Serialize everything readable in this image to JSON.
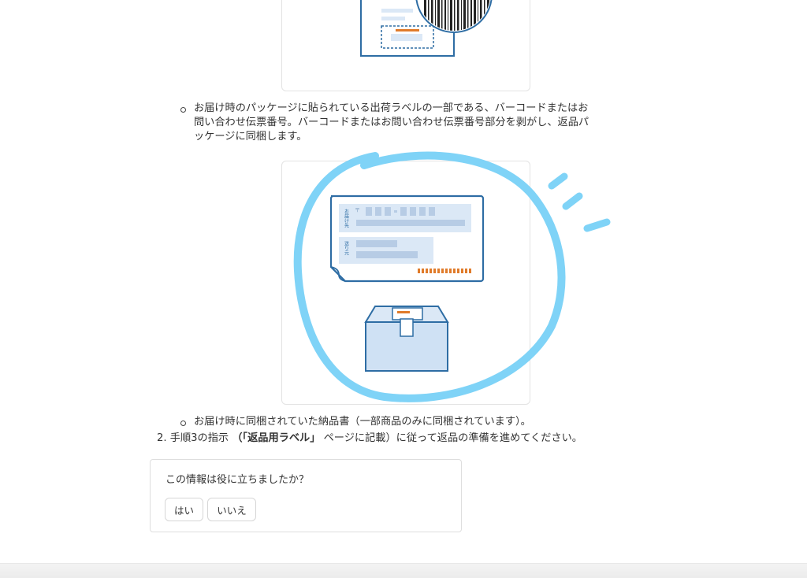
{
  "bullets": {
    "barcode_label_text": "お届け時のパッケージに貼られている出荷ラベルの一部である、バーコードまたはお問い合わせ伝票番号。バーコードまたはお問い合わせ伝票番号部分を剥がし、返品パッケージに同梱します。",
    "barcode_label_lines": [
      "お届け時のパッケージに貼られている出荷ラベルの一部である、バーコードまたはお",
      "問い合わせ伝票番号。バーコードまたはお問い合わせ伝票番号部分を剥がし、返品パ",
      "ッケージに同梱します。"
    ],
    "invoice_text": "お届け時に同梱されていた納品書（一部商品のみに同梱されています）。"
  },
  "illustration": {
    "label_recipient": "お届け先",
    "label_sender": "送り元",
    "postal_mark": "〒"
  },
  "step": {
    "number": "2.",
    "prefix": "手順3の指示",
    "bold": "（「返品用ラベル」",
    "suffix": "ページに記載）に従って返品の準備を進めてください。"
  },
  "feedback": {
    "question": "この情報は役に立ちましたか？",
    "yes_label": "はい",
    "no_label": "いいえ"
  },
  "colors": {
    "illustration_stroke": "#2e6da4",
    "illustration_fill": "#dbe8f6",
    "barcode_orange": "#e07b2a",
    "highlight_scribble": "#7fd3f7"
  }
}
